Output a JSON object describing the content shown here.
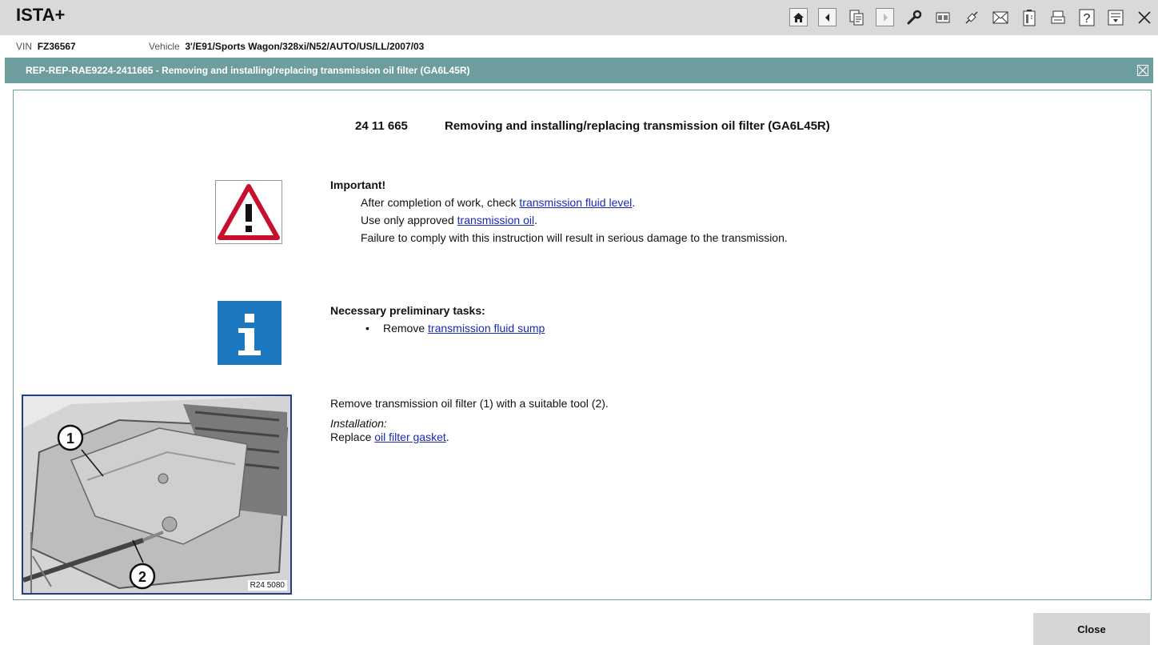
{
  "app": {
    "title": "ISTA+"
  },
  "toolbar": {
    "icons": [
      "home-icon",
      "back-icon",
      "document-copy-icon",
      "forward-icon",
      "wrench-icon",
      "gearbox-icon",
      "cable-icon",
      "mail-icon",
      "battery-icon",
      "print-icon",
      "help-icon",
      "download-icon",
      "close-icon"
    ]
  },
  "vehicle": {
    "vin_label": "VIN",
    "vin": "FZ36567",
    "vehicle_label": "Vehicle",
    "vehicle_value": "3'/E91/Sports Wagon/328xi/N52/AUTO/US/LL/2007/03"
  },
  "document": {
    "header_title": "REP-REP-RAE9224-2411665  -  Removing and installing/replacing transmission oil filter (GA6L45R)",
    "number": "24 11 665",
    "title": "Removing and installing/replacing transmission oil filter (GA6L45R)"
  },
  "important": {
    "heading": "Important!",
    "line1_text": "After completion of work, check ",
    "line1_link": "transmission fluid level",
    "line1_end": ".",
    "line2_text": "Use only approved ",
    "line2_link": "transmission oil",
    "line2_end": ".",
    "line3_text": "Failure to comply with this instruction will result in serious damage to the transmission."
  },
  "preliminary": {
    "heading": "Necessary preliminary tasks:",
    "bullet": "•",
    "item_text": "Remove ",
    "item_link": "transmission fluid sump"
  },
  "step": {
    "instruction": "Remove transmission oil filter (1) with a suitable tool (2).",
    "install_label": "Installation:",
    "replace_text": "Replace ",
    "replace_link": "oil filter gasket",
    "replace_end": ".",
    "figure_callout_1": "1",
    "figure_callout_2": "2",
    "figure_number": "R24 5080"
  },
  "footer": {
    "close_label": "Close"
  },
  "colors": {
    "header_bar": "#6e9d9e",
    "link": "#1a29b8",
    "info_blue": "#1b78c1",
    "warning_red": "#c8102e"
  }
}
